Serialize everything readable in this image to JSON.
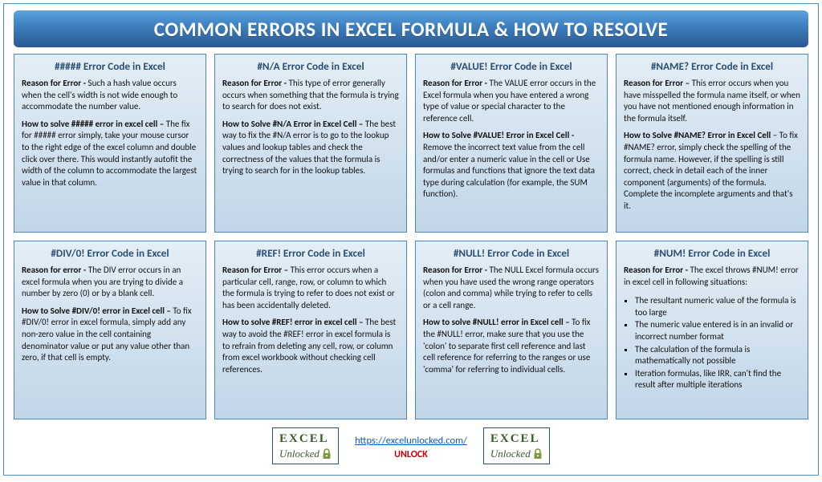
{
  "title": "COMMON ERRORS IN EXCEL FORMULA & HOW TO RESOLVE",
  "cards": [
    {
      "title": "##### Error Code in Excel",
      "reason_label": "Reason for Error - ",
      "reason_text": "Such a hash value occurs when the cell's width is not wide enough to accommodate the number value.",
      "solve_label": "How to solve ##### error in excel cell – ",
      "solve_text": "The fix for ##### error simply, take your mouse cursor to the right edge of the excel column and double click over there. This would instantly autofit the width of the column to accommodate the largest value in that column."
    },
    {
      "title": "#N/A Error Code in Excel",
      "reason_label": "Reason for Error - ",
      "reason_text": "This type of error generally occurs when something that the formula is trying to search for does not exist.",
      "solve_label": "How to Solve #N/A Error in Excel Cell – ",
      "solve_text": "The best way to fix the #N/A error is to go to the lookup values and lookup tables and check the correctness of the values that the formula is trying to search for in the lookup tables."
    },
    {
      "title": "#VALUE! Error Code in Excel",
      "reason_label": "Reason for Error - ",
      "reason_text": "The VALUE error occurs in the Excel formula when you have entered a wrong type of value or special character to the reference cell.",
      "solve_label": "How to Solve #VALUE! Error in Excel Cell - ",
      "solve_text": "Remove the incorrect text value from the cell and/or enter a numeric value in the cell or Use formulas and functions that ignore the text data type during calculation (for example, the SUM function)."
    },
    {
      "title": "#NAME? Error Code in Excel",
      "reason_label": "Reason for Error – ",
      "reason_text": "This error occurs when you have misspelled the formula name itself, or when you have not mentioned enough information in the formula itself.",
      "solve_label": "How to Solve #NAME? Error in Excel Cell ",
      "solve_text": "– To fix #NAME? error, simply check the spelling of the formula name. However, if the spelling is still correct, check in detail each of the inner component (arguments) of the formula. Complete the incomplete arguments and that's it."
    },
    {
      "title": "#DIV/0! Error Code in Excel",
      "reason_label": "Reason for error - ",
      "reason_text": "The DIV error occurs in an excel formula when you are trying to divide a number by zero (0) or by a blank cell.",
      "solve_label": "How to Solve #DIV/0! error in Excel cell – ",
      "solve_text": "To fix #DIV/0! error in excel formula, simply add any non-zero value in the cell containing denominator value or put any value other than zero, if that cell is empty."
    },
    {
      "title": "#REF! Error Code in Excel",
      "reason_label": "Reason for Error – ",
      "reason_text": "This error occurs when a particular cell, range, row, or column to which the formula is trying to refer to does not exist or has been accidentally deleted.",
      "solve_label": "How to solve #REF! error in excel cell – ",
      "solve_text": "The best way to avoid the #REF! error in excel formula is to refrain from deleting any cell, row, or column from excel workbook without checking cell references."
    },
    {
      "title": "#NULL! Error Code in Excel",
      "reason_label": "Reason for Error - ",
      "reason_text": "The NULL Excel formula occurs when you have used the wrong range operators (colon and comma) while trying to refer to cells or a cell range.",
      "solve_label": "How to solve #NULL! error in Excel cell – ",
      "solve_text": "To fix the #NULL! error, make sure that you use the 'colon' to separate first cell reference and last cell reference for referring to the ranges or use 'comma' for referring to individual cells."
    },
    {
      "title": "#NUM! Error Code in Excel",
      "reason_label": "Reason for Error - ",
      "reason_text": "The excel throws #NUM! error in excel cell in following situations:",
      "bullets": [
        "The resultant numeric value of the formula is too large",
        "The numeric value entered is in an invalid or incorrect number format",
        "The calculation of the formula is mathematically not possible",
        "Iteration formulas, like IRR, can't find the result after multiple iterations"
      ]
    }
  ],
  "footer": {
    "logo_big": "EXCEL",
    "logo_small": "Unlocked",
    "url": "https://excelunlocked.com/",
    "unlock": "UNLOCK"
  },
  "colors": {
    "title_gradient_top": "#5aa4e0",
    "title_gradient_bottom": "#2a5a94",
    "card_border": "#4a86b8"
  }
}
